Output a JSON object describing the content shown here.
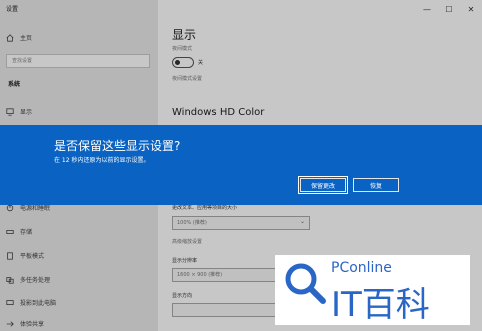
{
  "window": {
    "title": "设置"
  },
  "sidebar": {
    "home": "主页",
    "search_placeholder": "查找设置",
    "section": "系统",
    "items": [
      {
        "label": "显示",
        "top": 0
      },
      {
        "label": "电源和睡眠"
      },
      {
        "label": "存储"
      },
      {
        "label": "平板模式"
      },
      {
        "label": "多任务处理"
      },
      {
        "label": "投影到此电脑"
      },
      {
        "label": "体验共享"
      }
    ]
  },
  "main": {
    "title": "显示",
    "night_light_caption": "夜间模式",
    "night_light_state": "关",
    "night_light_settings": "夜间模式设置",
    "hdr_title": "Windows HD Color",
    "scale_label": "更改文本、应用等项目的大小",
    "scale_value": "100% (推荐)",
    "advanced_scale": "高级缩放设置",
    "resolution_label": "显示分辨率",
    "resolution_value": "1600 × 900 (推荐)",
    "orientation_label": "显示方向"
  },
  "dialog": {
    "title": "是否保留这些显示设置?",
    "subtitle": "在 12 秒内还原为以前的显示设置。",
    "keep_label": "保留更改",
    "revert_label": "恢复"
  },
  "watermark": {
    "line1": "PConline",
    "line2": "IT百科"
  },
  "colors": {
    "dialog_bg": "#0a63c2",
    "watermark": "#2a66c6"
  }
}
